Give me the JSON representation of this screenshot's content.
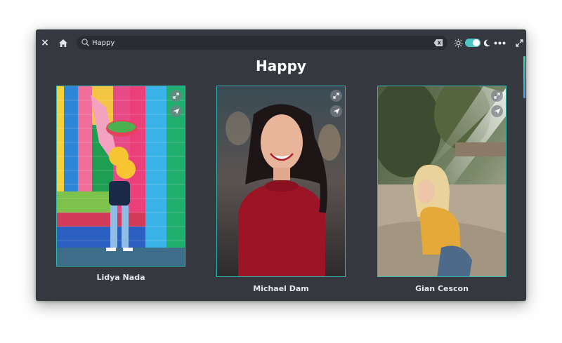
{
  "window": {
    "search_value": "Happy",
    "close_icon": "close-icon",
    "home_icon": "home-icon",
    "theme_toggle": "on",
    "accent": "#4fc4c4"
  },
  "page": {
    "title": "Happy"
  },
  "cards": [
    {
      "name": "Lidya Nada"
    },
    {
      "name": "Michael Dam"
    },
    {
      "name": "Gian Cescon"
    }
  ]
}
